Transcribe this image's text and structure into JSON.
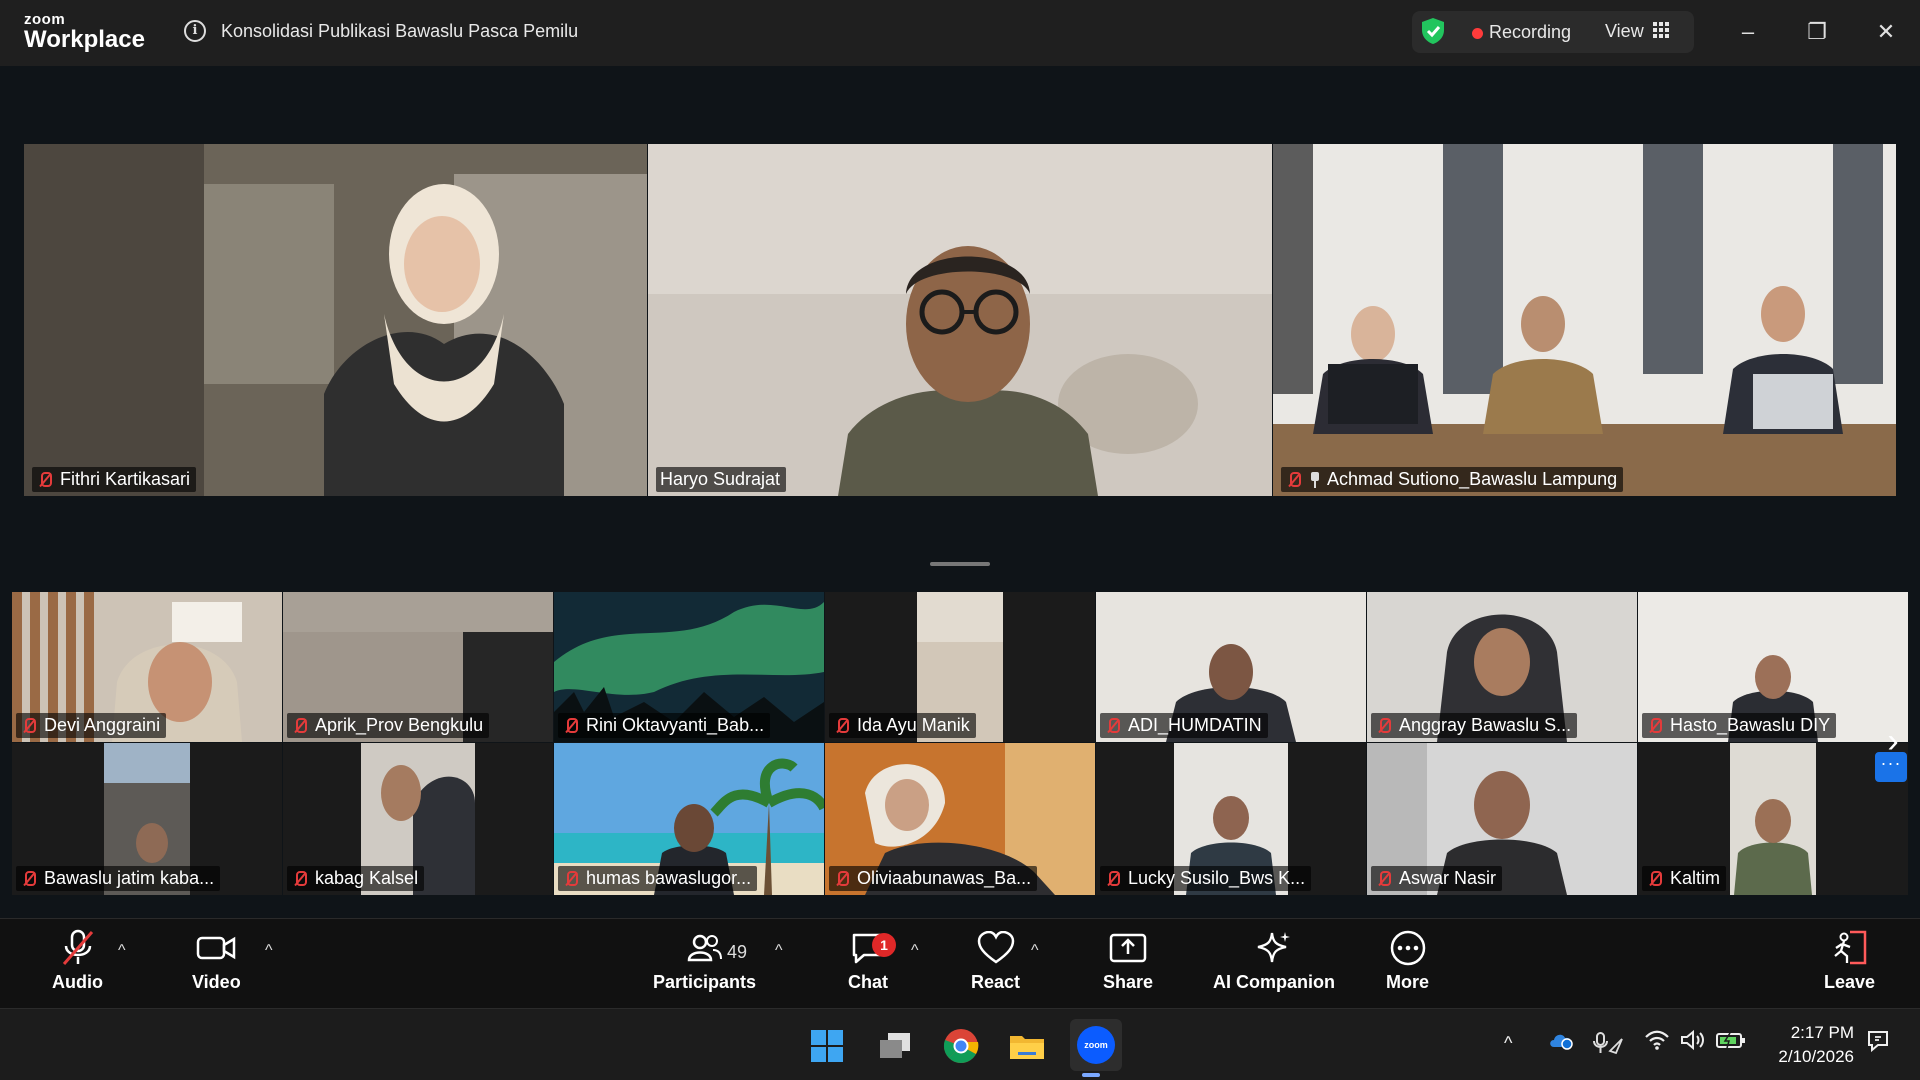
{
  "app": {
    "brand_top": "zoom",
    "brand_bottom": "Workplace",
    "meeting_title": "Konsolidasi Publikasi Bawaslu Pasca Pemilu"
  },
  "status": {
    "recording_label": "Recording",
    "view_label": "View"
  },
  "window_controls": {
    "minimize": "–",
    "restore": "❐",
    "close": "✕"
  },
  "speakers": [
    {
      "name": "Fithri Kartikasari",
      "muted": true
    },
    {
      "name": "Haryo Sudrajat",
      "muted": false,
      "active": true
    },
    {
      "name": "Achmad Sutiono_Bawaslu Lampung",
      "muted": true,
      "pinned": true
    }
  ],
  "gallery": [
    {
      "name": "Devi Anggraini"
    },
    {
      "name": "Aprik_Prov Bengkulu"
    },
    {
      "name": "Rini Oktavyanti_Bab..."
    },
    {
      "name": "Ida Ayu Manik"
    },
    {
      "name": "ADI_HUMDATIN"
    },
    {
      "name": "Anggray Bawaslu S..."
    },
    {
      "name": "Hasto_Bawaslu DIY"
    },
    {
      "name": "Bawaslu jatim kaba..."
    },
    {
      "name": "kabag Kalsel"
    },
    {
      "name": "humas bawaslugor..."
    },
    {
      "name": "Oliviaabunawas_Ba..."
    },
    {
      "name": "Lucky Susilo_Bws K..."
    },
    {
      "name": "Aswar Nasir"
    },
    {
      "name": "Kaltim"
    }
  ],
  "toolbar": {
    "audio": "Audio",
    "video": "Video",
    "participants": "Participants",
    "participants_count": "49",
    "chat": "Chat",
    "chat_badge": "1",
    "react": "React",
    "share": "Share",
    "ai_companion": "AI Companion",
    "more": "More",
    "leave": "Leave"
  },
  "taskbar": {
    "time": "2:17 PM",
    "date": "2/10/2026",
    "zoom_app_label": "zoom"
  },
  "colors": {
    "active_speaker_border": "#2ed66b",
    "recording_dot": "#ff3b3b",
    "mute_red": "#e43b3b",
    "chat_badge": "#e02828",
    "accent_blue": "#1a73e8"
  }
}
